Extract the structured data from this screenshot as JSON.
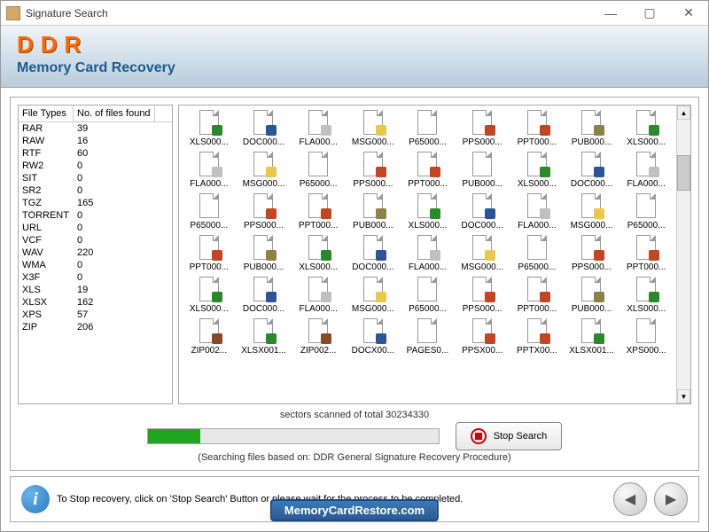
{
  "window": {
    "title": "Signature Search"
  },
  "header": {
    "logo": "DDR",
    "subtitle": "Memory Card Recovery"
  },
  "leftPane": {
    "headers": [
      "File Types",
      "No. of files found"
    ],
    "rows": [
      {
        "type": "RAR",
        "count": "39"
      },
      {
        "type": "RAW",
        "count": "16"
      },
      {
        "type": "RTF",
        "count": "60"
      },
      {
        "type": "RW2",
        "count": "0"
      },
      {
        "type": "SIT",
        "count": "0"
      },
      {
        "type": "SR2",
        "count": "0"
      },
      {
        "type": "TGZ",
        "count": "165"
      },
      {
        "type": "TORRENT",
        "count": "0"
      },
      {
        "type": "URL",
        "count": "0"
      },
      {
        "type": "VCF",
        "count": "0"
      },
      {
        "type": "WAV",
        "count": "220"
      },
      {
        "type": "WMA",
        "count": "0"
      },
      {
        "type": "X3F",
        "count": "0"
      },
      {
        "type": "XLS",
        "count": "19"
      },
      {
        "type": "XLSX",
        "count": "162"
      },
      {
        "type": "XPS",
        "count": "57"
      },
      {
        "type": "ZIP",
        "count": "206"
      }
    ]
  },
  "fileGrid": {
    "rows": [
      [
        {
          "n": "XLS000...",
          "b": "xls"
        },
        {
          "n": "DOC000...",
          "b": "doc"
        },
        {
          "n": "FLA000...",
          "b": "fla"
        },
        {
          "n": "MSG000...",
          "b": "msg"
        },
        {
          "n": "P65000...",
          "b": ""
        },
        {
          "n": "PPS000...",
          "b": "pps"
        },
        {
          "n": "PPT000...",
          "b": "ppt"
        },
        {
          "n": "PUB000...",
          "b": "pub"
        },
        {
          "n": "XLS000...",
          "b": "xls"
        }
      ],
      [
        {
          "n": "FLA000...",
          "b": "fla"
        },
        {
          "n": "MSG000...",
          "b": "msg"
        },
        {
          "n": "P65000...",
          "b": ""
        },
        {
          "n": "PPS000...",
          "b": "pps"
        },
        {
          "n": "PPT000...",
          "b": "ppt"
        },
        {
          "n": "PUB000...",
          "b": ""
        },
        {
          "n": "XLS000...",
          "b": "xls"
        },
        {
          "n": "DOC000...",
          "b": "doc"
        },
        {
          "n": "FLA000...",
          "b": "fla"
        }
      ],
      [
        {
          "n": "P65000...",
          "b": ""
        },
        {
          "n": "PPS000...",
          "b": "pps"
        },
        {
          "n": "PPT000...",
          "b": "ppt"
        },
        {
          "n": "PUB000...",
          "b": "pub"
        },
        {
          "n": "XLS000...",
          "b": "xls"
        },
        {
          "n": "DOC000...",
          "b": "doc"
        },
        {
          "n": "FLA000...",
          "b": "fla"
        },
        {
          "n": "MSG000...",
          "b": "msg"
        },
        {
          "n": "P65000...",
          "b": ""
        }
      ],
      [
        {
          "n": "PPT000...",
          "b": "ppt"
        },
        {
          "n": "PUB000...",
          "b": "pub"
        },
        {
          "n": "XLS000...",
          "b": "xls"
        },
        {
          "n": "DOC000...",
          "b": "doc"
        },
        {
          "n": "FLA000...",
          "b": "fla"
        },
        {
          "n": "MSG000...",
          "b": "msg"
        },
        {
          "n": "P65000...",
          "b": ""
        },
        {
          "n": "PPS000...",
          "b": "pps"
        },
        {
          "n": "PPT000...",
          "b": "ppt"
        }
      ],
      [
        {
          "n": "XLS000...",
          "b": "xls"
        },
        {
          "n": "DOC000...",
          "b": "doc"
        },
        {
          "n": "FLA000...",
          "b": "fla"
        },
        {
          "n": "MSG000...",
          "b": "msg"
        },
        {
          "n": "P65000...",
          "b": ""
        },
        {
          "n": "PPS000...",
          "b": "pps"
        },
        {
          "n": "PPT000...",
          "b": "ppt"
        },
        {
          "n": "PUB000...",
          "b": "pub"
        },
        {
          "n": "XLS000...",
          "b": "xls"
        }
      ],
      [
        {
          "n": "ZIP002...",
          "b": "zip"
        },
        {
          "n": "XLSX001...",
          "b": "xls"
        },
        {
          "n": "ZIP002...",
          "b": "zip"
        },
        {
          "n": "DOCX00...",
          "b": "doc"
        },
        {
          "n": "PAGES0...",
          "b": ""
        },
        {
          "n": "PPSX00...",
          "b": "pps"
        },
        {
          "n": "PPTX00...",
          "b": "ppt"
        },
        {
          "n": "XLSX001...",
          "b": "xls"
        },
        {
          "n": "XPS000...",
          "b": ""
        }
      ]
    ]
  },
  "progress": {
    "statusText": "sectors scanned of total 30234330",
    "stopLabel": "Stop Search",
    "note": "(Searching files based on:  DDR General Signature Recovery Procedure)"
  },
  "footer": {
    "hint": "To Stop recovery, click on 'Stop Search' Button or please wait for the process to be completed.",
    "website": "MemoryCardRestore.com"
  }
}
